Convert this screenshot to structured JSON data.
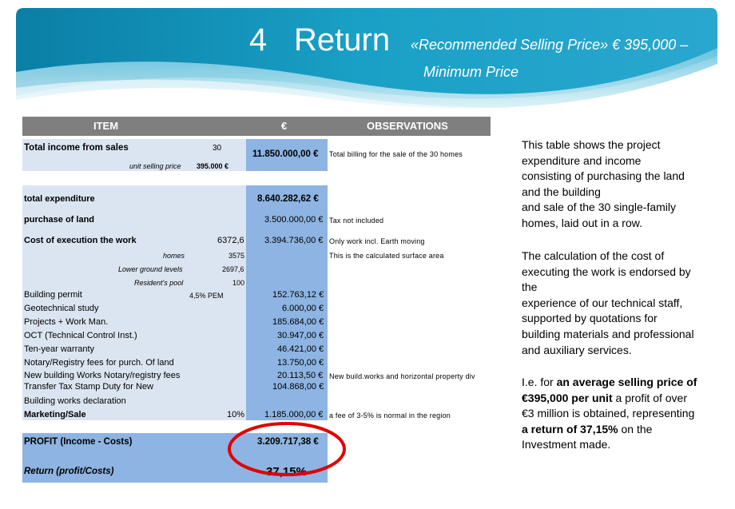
{
  "title": {
    "number": "4",
    "word": "Return",
    "subtitle_line1": "«Recommended Selling Price» € 395,000 –",
    "subtitle_line2": "Minimum Price"
  },
  "header": {
    "item": "ITEM",
    "euro": "€",
    "observations": "OBSERVATIONS"
  },
  "income": {
    "label": "Total income from sales",
    "units": "30",
    "sub_label": "unit selling price",
    "sub_value": "395.000 €",
    "value": "11.850.000,00 €",
    "obs": "Total billing for the sale of the 30 homes"
  },
  "expenditure": {
    "label": "total expenditure",
    "value": "8.640.282,62 €"
  },
  "land": {
    "label": "purchase of land",
    "value": "3.500.000,00 €",
    "obs": "Tax not included"
  },
  "execution": {
    "label": "Cost of execution the work",
    "qty": "6372,6",
    "value": "3.394.736,00 €",
    "obs": "Only work incl. Earth moving",
    "sub": [
      {
        "label": "homes",
        "qty": "3575",
        "obs": "This is the calculated surface area"
      },
      {
        "label": "Lower ground levels",
        "qty": "2697,6"
      },
      {
        "label": "Resident's pool",
        "qty": "100"
      }
    ]
  },
  "items": [
    {
      "label": "Building permit",
      "note": "4,5% PEM",
      "value": "152.763,12 €"
    },
    {
      "label": "Geotechnical study",
      "value": "6.000,00 €"
    },
    {
      "label": "Projects + Work Man.",
      "value": "185.684,00 €"
    },
    {
      "label": "OCT (Technical Control Inst.)",
      "value": "30.947,00 €"
    },
    {
      "label": "Ten-year warranty",
      "value": "46.421,00 €"
    },
    {
      "label": "Notary/Registry fees for purch. Of land",
      "value": "13.750,00 €"
    },
    {
      "label": "New building Works Notary/registry fees",
      "value": "20.113,50 €",
      "obs": "New build.works and horizontal property div"
    },
    {
      "label": "Transfer Tax Stamp Duty for New",
      "value": "104.868,00 €"
    },
    {
      "label": "Building works declaration"
    }
  ],
  "marketing": {
    "label": "Marketing/Sale",
    "pct": "10%",
    "value": "1.185.000,00 €",
    "obs": "a fee of 3-5% is normal in the region"
  },
  "profit": {
    "label": "PROFIT (Income - Costs)",
    "value": "3.209.717,38 €"
  },
  "return": {
    "label": "Return (profit/Costs)",
    "value": "37,15%"
  },
  "notes": {
    "p1": [
      "This table shows the project",
      "expenditure and income",
      "consisting of purchasing the land",
      "and the building",
      "and sale of the 30 single-family",
      "homes, laid out in a row."
    ],
    "p2": [
      "The calculation of the cost of",
      "executing the work is endorsed by",
      "the",
      "experience of our technical staff,",
      "supported by quotations for",
      "building materials and professional",
      "and auxiliary services."
    ],
    "p3": {
      "l1_pre": "I.e. for ",
      "l1_bold": "an average selling price of",
      "l2_bold": "€395,000 per unit",
      "l2_post": " a profit of over",
      "l3": "€3 million is obtained, representing",
      "l4_bold": "a return of 37,15%",
      "l4_post": " on the",
      "l5": "Investment made."
    }
  },
  "colors": {
    "label_bg": "#dbe5f1",
    "value_bg": "#8db4e2",
    "header_bg": "#7f7f7f",
    "highlight": "#e00000"
  }
}
